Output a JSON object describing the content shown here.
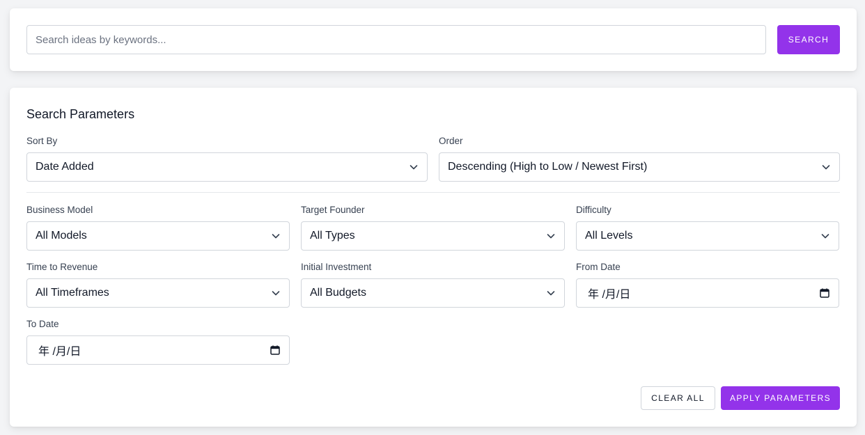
{
  "search": {
    "placeholder": "Search ideas by keywords...",
    "button_label": "SEARCH"
  },
  "params": {
    "title": "Search Parameters",
    "sort_by": {
      "label": "Sort By",
      "value": "Date Added"
    },
    "order": {
      "label": "Order",
      "value": "Descending (High to Low / Newest First)"
    },
    "business_model": {
      "label": "Business Model",
      "value": "All Models"
    },
    "target_founder": {
      "label": "Target Founder",
      "value": "All Types"
    },
    "difficulty": {
      "label": "Difficulty",
      "value": "All Levels"
    },
    "time_to_revenue": {
      "label": "Time to Revenue",
      "value": "All Timeframes"
    },
    "initial_investment": {
      "label": "Initial Investment",
      "value": "All Budgets"
    },
    "from_date": {
      "label": "From Date",
      "value": "年 /月/日"
    },
    "to_date": {
      "label": "To Date",
      "value": "年 /月/日"
    },
    "clear_label": "CLEAR ALL",
    "apply_label": "APPLY PARAMETERS"
  },
  "colors": {
    "accent": "#9333ea",
    "background": "#f3f4f6",
    "border": "#d1d5db"
  },
  "icons": {
    "select": "chevron-down-icon",
    "date": "calendar-icon"
  }
}
